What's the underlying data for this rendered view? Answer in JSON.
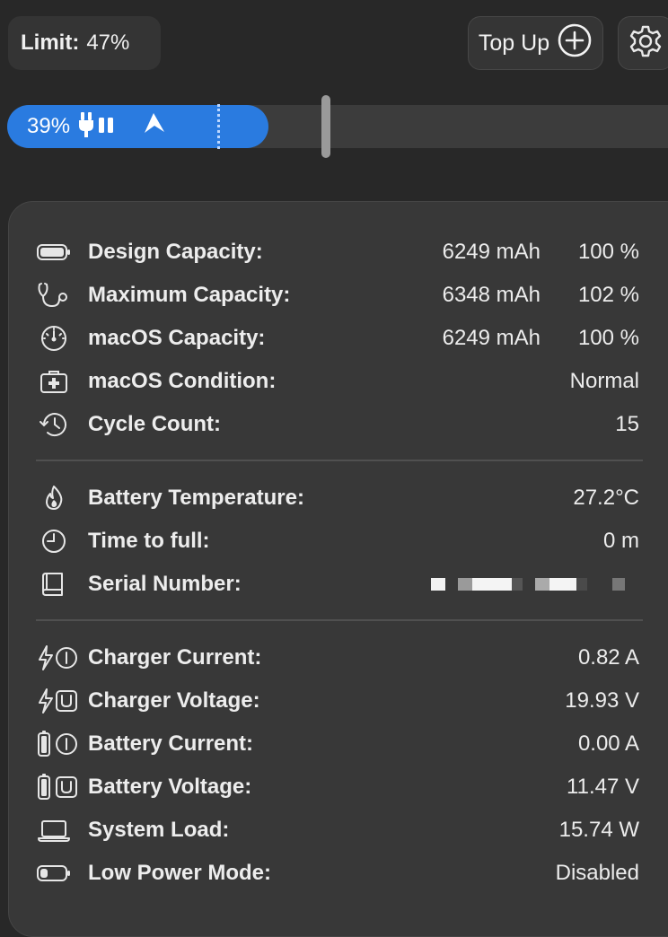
{
  "limit": {
    "label": "Limit:",
    "value": "47%"
  },
  "topup": {
    "label": "Top Up"
  },
  "charge_bar": {
    "percent_text": "39%",
    "charge_level": 0.39,
    "limit_level": 0.47
  },
  "rows": {
    "design_capacity": {
      "label": "Design Capacity:",
      "value": "6249 mAh",
      "percent": "100 %"
    },
    "maximum_capacity": {
      "label": "Maximum Capacity:",
      "value": "6348 mAh",
      "percent": "102 %"
    },
    "macos_capacity": {
      "label": "macOS Capacity:",
      "value": "6249 mAh",
      "percent": "100 %"
    },
    "macos_condition": {
      "label": "macOS Condition:",
      "value": "Normal"
    },
    "cycle_count": {
      "label": "Cycle Count:",
      "value": "15"
    },
    "battery_temperature": {
      "label": "Battery Temperature:",
      "value": "27.2°C"
    },
    "time_to_full": {
      "label": "Time to full:",
      "value": "0 m"
    },
    "serial_number": {
      "label": "Serial Number:"
    },
    "charger_current": {
      "label": "Charger Current:",
      "value": "0.82 A"
    },
    "charger_voltage": {
      "label": "Charger Voltage:",
      "value": "19.93 V"
    },
    "battery_current": {
      "label": "Battery Current:",
      "value": "0.00 A"
    },
    "battery_voltage": {
      "label": "Battery Voltage:",
      "value": "11.47 V"
    },
    "system_load": {
      "label": "System Load:",
      "value": "15.74 W"
    },
    "low_power_mode": {
      "label": "Low Power Mode:",
      "value": "Disabled"
    }
  },
  "icons": {
    "plug": "plug-icon",
    "location": "location-arrow-icon",
    "add": "plus-circle-icon",
    "settings": "gear-icon"
  },
  "colors": {
    "accent": "#2a7be0",
    "background": "#282828",
    "panel": "#383838"
  }
}
